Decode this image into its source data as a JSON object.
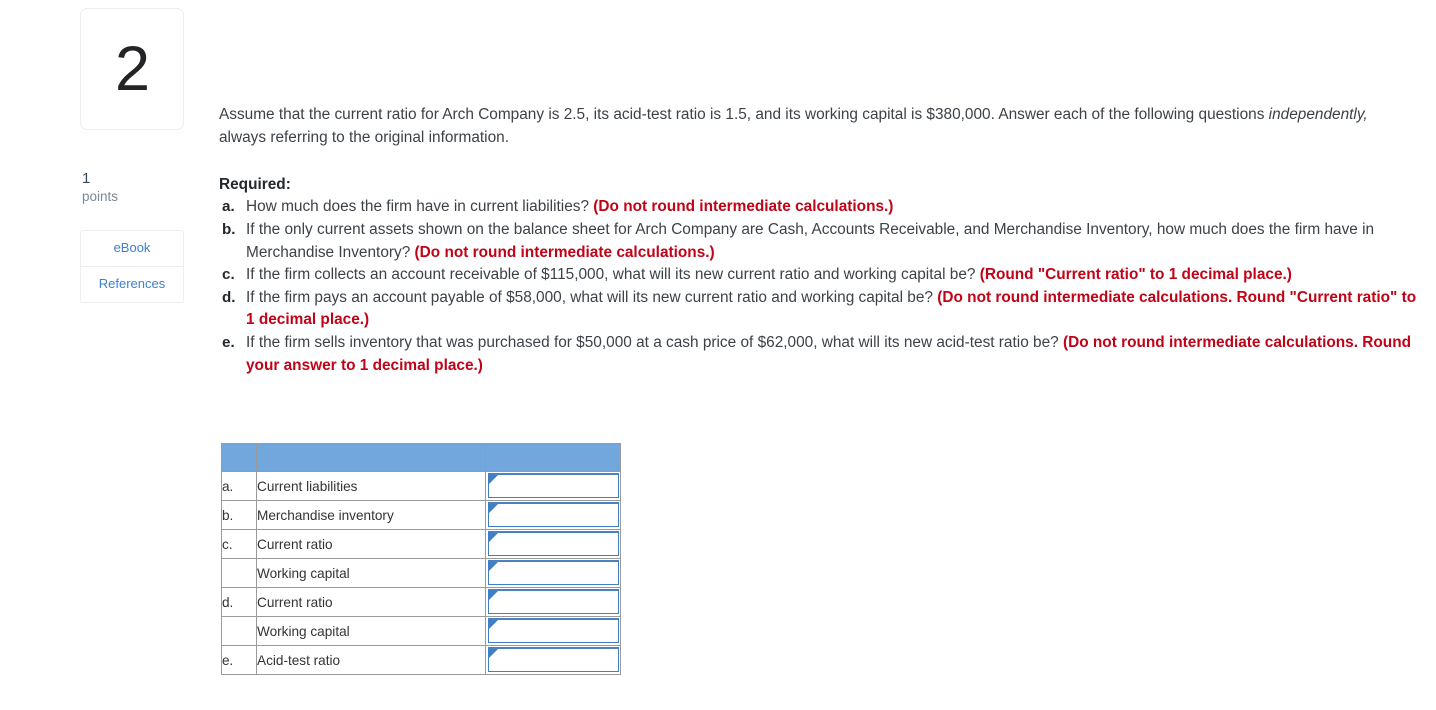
{
  "question": {
    "number": "2",
    "points_value": "1",
    "points_label": "points"
  },
  "resources": {
    "ebook_label": "eBook",
    "references_label": "References"
  },
  "intro": {
    "part1": "Assume that the current ratio for Arch Company is 2.5, its acid-test ratio is 1.5, and its working capital is $380,000. Answer each of the following questions ",
    "italic": "independently,",
    "part2": " always referring to the original information."
  },
  "required_heading": "Required:",
  "items": [
    {
      "marker": "a.",
      "text": "How much does the firm have in current liabilities? ",
      "bold_red": "(Do not round intermediate calculations.)"
    },
    {
      "marker": "b.",
      "text": "If the only current assets shown on the balance sheet for Arch Company are Cash, Accounts Receivable, and Merchandise Inventory, how much does the firm have in Merchandise Inventory? ",
      "bold_red": "(Do not round intermediate calculations.)"
    },
    {
      "marker": "c.",
      "text": "If the firm collects an account receivable of $115,000, what will its new current ratio and working capital be? ",
      "bold_red": "(Round \"Current ratio\" to 1 decimal place.)"
    },
    {
      "marker": "d.",
      "text": "If the firm pays an account payable of $58,000, what will its new current ratio and working capital be? ",
      "bold_red": "(Do not round intermediate calculations. Round \"Current ratio\" to 1 decimal place.)"
    },
    {
      "marker": "e.",
      "text": "If the firm sells inventory that was purchased for $50,000 at a cash price of $62,000, what will its new acid-test ratio be? ",
      "bold_red": "(Do not round intermediate calculations. Round your answer to 1 decimal place.)"
    }
  ],
  "answer_table": {
    "header": [
      "",
      "",
      ""
    ],
    "rows": [
      {
        "letter": "a.",
        "label": "Current liabilities",
        "value": ""
      },
      {
        "letter": "b.",
        "label": "Merchandise inventory",
        "value": ""
      },
      {
        "letter": "c.",
        "label": "Current ratio",
        "value": ""
      },
      {
        "letter": "",
        "label": "Working capital",
        "value": ""
      },
      {
        "letter": "d.",
        "label": "Current ratio",
        "value": ""
      },
      {
        "letter": "",
        "label": "Working capital",
        "value": ""
      },
      {
        "letter": "e.",
        "label": "Acid-test ratio",
        "value": ""
      }
    ]
  },
  "colors": {
    "red_instruction": "#c00418",
    "table_header_blue": "#72a7de",
    "input_border_blue": "#3f7fc4",
    "link_blue": "#3f7fd0"
  }
}
